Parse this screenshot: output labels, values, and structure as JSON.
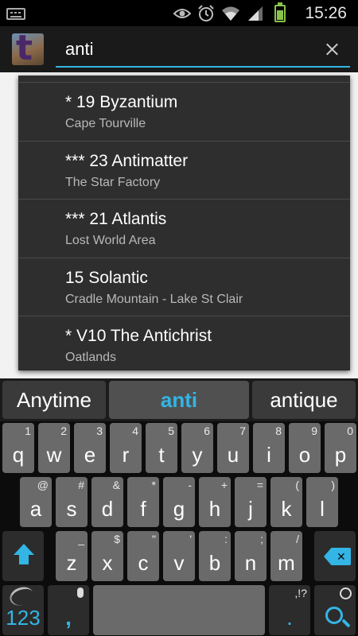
{
  "status_bar": {
    "time": "15:26",
    "icons": [
      "keyboard-icon",
      "eye-icon",
      "alarm-icon",
      "wifi-icon",
      "signal-icon",
      "battery-icon"
    ]
  },
  "action_bar": {
    "app_icon_letter": "t",
    "search_value": "anti"
  },
  "suggestions": [
    {
      "title": "* 19 Byzantium",
      "subtitle": "Cape Tourville"
    },
    {
      "title": "*** 23 Antimatter",
      "subtitle": "The Star Factory"
    },
    {
      "title": "*** 21 Atlantis",
      "subtitle": "Lost World Area"
    },
    {
      "title": "15 Solantic",
      "subtitle": "Cradle Mountain - Lake St Clair"
    },
    {
      "title": "* V10 The Antichrist",
      "subtitle": "Oatlands"
    }
  ],
  "keyboard": {
    "word_suggestions": [
      "Anytime",
      "anti",
      "antique"
    ],
    "row1": [
      {
        "k": "q",
        "s": "1"
      },
      {
        "k": "w",
        "s": "2"
      },
      {
        "k": "e",
        "s": "3"
      },
      {
        "k": "r",
        "s": "4"
      },
      {
        "k": "t",
        "s": "5"
      },
      {
        "k": "y",
        "s": "6"
      },
      {
        "k": "u",
        "s": "7"
      },
      {
        "k": "i",
        "s": "8"
      },
      {
        "k": "o",
        "s": "9"
      },
      {
        "k": "p",
        "s": "0"
      }
    ],
    "row2": [
      {
        "k": "a",
        "s": "@"
      },
      {
        "k": "s",
        "s": "#"
      },
      {
        "k": "d",
        "s": "&"
      },
      {
        "k": "f",
        "s": "*"
      },
      {
        "k": "g",
        "s": "-"
      },
      {
        "k": "h",
        "s": "+"
      },
      {
        "k": "j",
        "s": "="
      },
      {
        "k": "k",
        "s": "("
      },
      {
        "k": "l",
        "s": ")"
      }
    ],
    "row3": [
      {
        "k": "z",
        "s": "_"
      },
      {
        "k": "x",
        "s": "$"
      },
      {
        "k": "c",
        "s": "\""
      },
      {
        "k": "v",
        "s": "'"
      },
      {
        "k": "b",
        "s": ":"
      },
      {
        "k": "n",
        "s": ";"
      },
      {
        "k": "m",
        "s": "/"
      }
    ],
    "num_label": "123",
    "comma_label": ",",
    "period_label": ".",
    "period_secondary": ",!?"
  },
  "colors": {
    "accent": "#33b5e5",
    "battery": "#8bc34a"
  }
}
